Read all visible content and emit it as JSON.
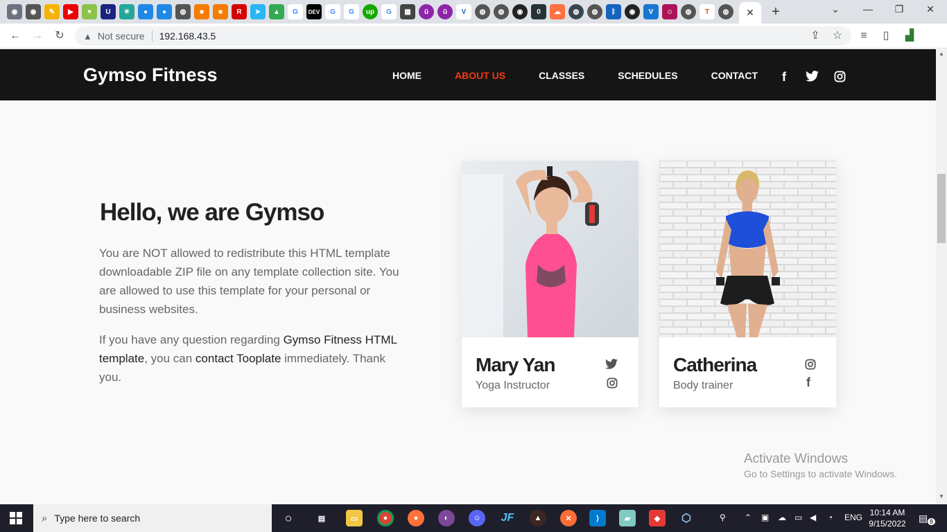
{
  "browser": {
    "address": {
      "security_label": "Not secure",
      "url": "192.168.43.5"
    },
    "tab_favicons": [
      "github-icon",
      "github-icon",
      "edit-icon",
      "youtube-icon",
      "heart-icon",
      "magnet-icon",
      "puzzle-icon",
      "drop-icon",
      "drop-icon",
      "globe-icon",
      "box-icon",
      "box-icon",
      "r-icon",
      "telegram-icon",
      "drive-icon",
      "google-icon",
      "dev-icon",
      "google-icon",
      "google-icon",
      "upwork-icon",
      "google-icon",
      "grid-icon",
      "u-icon",
      "u-icon",
      "v-icon",
      "globe-icon",
      "globe-icon",
      "github-icon",
      "o-icon",
      "cloud-icon",
      "globe-icon",
      "globe-icon",
      "bluetooth-icon",
      "github-icon",
      "vuetify-icon",
      "person-icon",
      "globe-icon",
      "t-icon",
      "globe-icon"
    ],
    "dev_tab_text": "DEV",
    "upwork_tab_text": "up"
  },
  "site": {
    "brand": "Gymso Fitness",
    "nav": [
      "HOME",
      "ABOUT US",
      "CLASSES",
      "SCHEDULES",
      "CONTACT"
    ],
    "active_nav": "ABOUT US",
    "accent_color": "#f13a11",
    "about": {
      "title": "Hello, we are Gymso",
      "para1": "You are NOT allowed to redistribute this HTML template downloadable ZIP file on any template collection site. You are allowed to use this template for your personal or business websites.",
      "para2_a": "If you have any question regarding ",
      "para2_link1": "Gymso Fitness HTML template",
      "para2_b": ", you can ",
      "para2_link2": "contact Tooplate",
      "para2_c": " immediately. Thank you."
    },
    "trainers": [
      {
        "name": "Mary Yan",
        "role": "Yoga Instructor",
        "social": [
          "twitter-icon",
          "instagram-icon"
        ]
      },
      {
        "name": "Catherina",
        "role": "Body trainer",
        "social": [
          "instagram-icon",
          "facebook-icon"
        ]
      }
    ]
  },
  "watermark": {
    "line1": "Activate Windows",
    "line2": "Go to Settings to activate Windows."
  },
  "taskbar": {
    "search_placeholder": "Type here to search",
    "app_labels": [
      "JF"
    ],
    "language": "ENG",
    "time": "10:14 AM",
    "date": "9/15/2022",
    "notification_count": "8"
  }
}
